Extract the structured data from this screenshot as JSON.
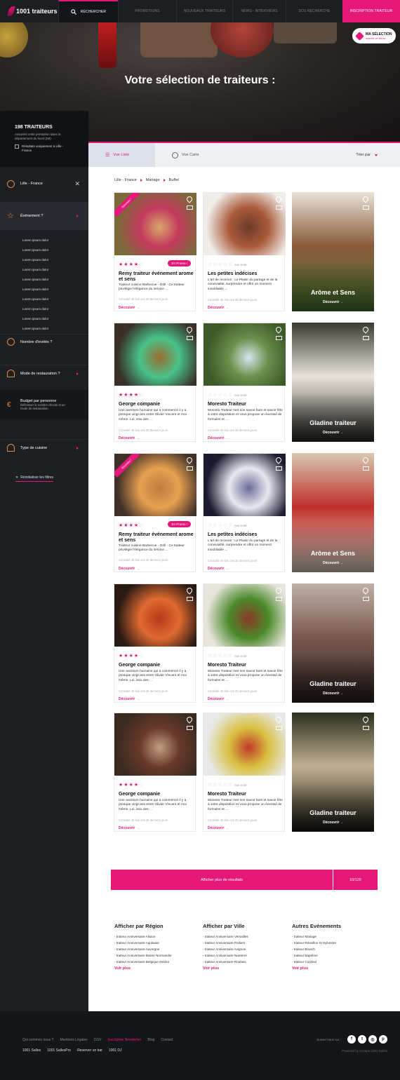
{
  "nav": {
    "brand": "1001 traiteurs",
    "items": [
      "RECHERCHER",
      "PROMOTIONS",
      "NOUVEAUX TRAITEURS",
      "NEWS - INTERVIEWS",
      "SOS RECHERCHE",
      "INSCRIPTION TRAITEUR"
    ]
  },
  "hero": {
    "title": "Votre sélection de traiteurs :",
    "ma_selection": "MA SÉLECTION",
    "ma_selection_sub": "obtenir un devis",
    "ma_selection_count": "1"
  },
  "sidebar": {
    "count": "198 TRAITEURS",
    "desc": "Assurent cette prestation dans le département du Nord (59)",
    "only_results": "Résultats uniquement à Lille - France",
    "location": "Lille - France",
    "event": "Événement ?",
    "sub_items": [
      "Lorem ipsum dolor",
      "Lorem ipsum dolor",
      "Lorem ipsum dolor",
      "Lorem ipsum dolor",
      "Lorem ipsum dolor",
      "Lorem ipsum dolor",
      "Lorem ipsum dolor",
      "Lorem ipsum dolor",
      "Lorem ipsum dolor",
      "Lorem ipsum dolor"
    ],
    "guests": "Nombre d'invités ?",
    "service": "Mode de restauration ?",
    "budget": "Budget par personne",
    "budget_sub": "Définissez le nombre d'invité et un mode de restauration",
    "cuisine": "Type de cuisine",
    "reset": "Réinitialiser les filtres"
  },
  "tabs": {
    "list": "Vue Liste",
    "map": "Vue Carte",
    "sort": "Trier par"
  },
  "breadcrumb": [
    "Lille - France",
    "Mariage",
    "Buffet"
  ],
  "cards": [
    {
      "name": "Remy traiteur événement arome et sens",
      "desc": "Traiteur cuisine Barbecue - Grill - Ce traiteur privilégie l'élégance du service ...",
      "meta": "Consulté 45 fois ces 30 derniers jours",
      "stars": 4,
      "promo": "En Promo !",
      "ribbon": "Nouveau !",
      "note": ""
    },
    {
      "name": "Les petites indécises",
      "desc": "L'art de recevoir : Le Plaisir du partage et de la convivialité, surprendre et offrir un moment inoubliable ...",
      "meta": "Consulté 45 fois ces 30 derniers jours",
      "stars": 0,
      "promo": "",
      "ribbon": "",
      "note": "non noté"
    },
    {
      "name": "George companie",
      "desc": "Une aventure humaine qui a commencé il y a presque vingt ans entre Olivier Vincent et moi même. Lui, issu des ...",
      "meta": "Consulté 45 fois ces 30 derniers jours",
      "stars": 4,
      "promo": "",
      "ribbon": "",
      "note": ""
    },
    {
      "name": "Moresto Traiteur",
      "desc": "Moresto Traiteur met son savoir faire et savoir fête à votre disposition et vous propose un éventail de formules et ...",
      "meta": "Consulté 45 fois ces 30 derniers jours",
      "stars": 0,
      "promo": "",
      "ribbon": "",
      "note": "non noté"
    },
    {
      "name": "Remy traiteur événement arome et sens",
      "desc": "Traiteur cuisine Barbecue - Grill - Ce traiteur privilégie l'élégance du service ...",
      "meta": "Consulté 45 fois ces 30 derniers jours",
      "stars": 4,
      "promo": "En Promo !",
      "ribbon": "Nouveau !",
      "note": ""
    },
    {
      "name": "Les petites indécises",
      "desc": "L'art de recevoir : Le Plaisir du partage et de la convivialité, surprendre et offrir un moment inoubliable ...",
      "meta": "Consulté 45 fois ces 30 derniers jours",
      "stars": 0,
      "promo": "",
      "ribbon": "",
      "note": "non noté"
    },
    {
      "name": "George companie",
      "desc": "Une aventure humaine qui a commencé il y a presque vingt ans entre Olivier Vincent et moi même. Lui, issu des ...",
      "meta": "Consulté 45 fois ces 30 derniers jours",
      "stars": 4,
      "promo": "",
      "ribbon": "",
      "note": ""
    },
    {
      "name": "Moresto Traiteur",
      "desc": "Moresto Traiteur met son savoir faire et savoir fête à votre disposition et vous propose un éventail de formules et ...",
      "meta": "Consulté 45 fois ces 30 derniers jours",
      "stars": 0,
      "promo": "",
      "ribbon": "",
      "note": "non noté"
    },
    {
      "name": "George companie",
      "desc": "Une aventure humaine qui a commencé il y a presque vingt ans entre Olivier Vincent et moi même. Lui, issu des ...",
      "meta": "Consulté 45 fois ces 30 derniers jours",
      "stars": 4,
      "promo": "",
      "ribbon": "",
      "note": ""
    },
    {
      "name": "Moresto Traiteur",
      "desc": "Moresto Traiteur met son savoir faire et savoir fête à votre disposition et vous propose un éventail de formules et ...",
      "meta": "Consulté 45 fois ces 30 derniers jours",
      "stars": 0,
      "promo": "",
      "ribbon": "",
      "note": "non noté"
    }
  ],
  "featured": [
    "Arôme et Sens",
    "Gladine traiteur",
    "Arôme et Sens",
    "Gladine traiteur",
    "Gladine traiteur"
  ],
  "discover": "Découvrir",
  "more": {
    "label": "Afficher plus de résultats",
    "count": "10/120"
  },
  "links": [
    {
      "title": "Afficher par Région",
      "items": [
        "- traiteur Anniversaire Alsace",
        "- traiteur Anniversaire Aquitaine",
        "- traiteur Anniversaire Auvergne",
        "- traiteur Anniversaire Basse Normandie",
        "- traiteur Anniversaire Belgique entière"
      ]
    },
    {
      "title": "Afficher par Ville",
      "items": [
        "- traiteur Anniversaire Versailles",
        "- traiteur Anniversaire Poitiers",
        "- traiteur Anniversaire Avignon",
        "- traiteur Anniversaire Nanterre",
        "- traiteur Anniversaire Roubaix"
      ]
    },
    {
      "title": "Autres Evénements",
      "items": [
        "- traiteur Mariage",
        "- traiteur Réveillon St Sylvestre",
        "- traiteur Brunch",
        "- traiteur Baptême",
        "- traiteur Cocktail"
      ]
    }
  ],
  "see_more": "Voir plus",
  "footer": {
    "row1": [
      "Qui sommes nous ?",
      "Mentions Légales",
      "CGV",
      "Inscription Newsletter",
      "Blog",
      "Contact"
    ],
    "row2": [
      "1001 Salles",
      "1001 SallesPro",
      "Reserver un bar",
      "1001 DJ"
    ],
    "follow": "Suivez-nous sur :",
    "powered": "Powered by Groupe 1001 Salles"
  },
  "colors": {
    "accent": "#e5187a",
    "dark": "#1e1f23"
  }
}
